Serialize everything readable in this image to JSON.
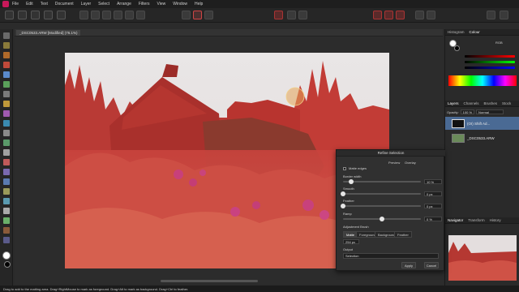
{
  "menubar": {
    "items": [
      "File",
      "Edit",
      "Text",
      "Document",
      "Layer",
      "Select",
      "Arrange",
      "Filters",
      "View",
      "Window",
      "Help"
    ]
  },
  "document": {
    "tab_label": "_DSC0533.ARW [Modified] (76.1%)"
  },
  "colors": {
    "accent_red": "#d32f2f",
    "selection_overlay": "#c8302c",
    "panel_bg": "#2a2a2a"
  },
  "right_panel": {
    "top_tabs": [
      "Histogram",
      "Colour"
    ],
    "color_model": "RGB",
    "layers_tabs": [
      "Layers",
      "Channels",
      "Brushes",
      "Stock"
    ],
    "opacity_label": "Opacity:",
    "opacity_value": "100 %",
    "blend_mode": "Normal",
    "layers": [
      {
        "name": "(OI) Shift Ad..."
      },
      {
        "name": "_DSC0533.ARW"
      }
    ],
    "nav_tabs": [
      "Navigator",
      "Transform",
      "History"
    ]
  },
  "refine_dialog": {
    "title": "Refine Selection",
    "preview_label": "Preview",
    "preview_mode": "Overlay",
    "matte_edges_label": "Matte edges",
    "border_width_label": "Border width",
    "border_width_value": "10 %",
    "border_width": 0.1,
    "smooth_label": "Smooth",
    "smooth_value": "0 px",
    "smooth": 0,
    "feather_label": "Feather",
    "feather_value": "0 px",
    "feather": 0,
    "ramp_label": "Ramp",
    "ramp_value": "0 %",
    "ramp": 0.5,
    "adjustment_brush_label": "Adjustment Brush",
    "brush_modes": [
      "Matte",
      "Foreground",
      "Background",
      "Feather"
    ],
    "brush_size": "254 px",
    "output_label": "Output",
    "output_value": "Selection",
    "apply_label": "Apply",
    "cancel_label": "Cancel"
  },
  "status": {
    "text": "Drag to add to the matting area. Drag+RightMouse to mark as foreground. Drag+Alt to mark as background. Drag+Ctrl to feather."
  }
}
